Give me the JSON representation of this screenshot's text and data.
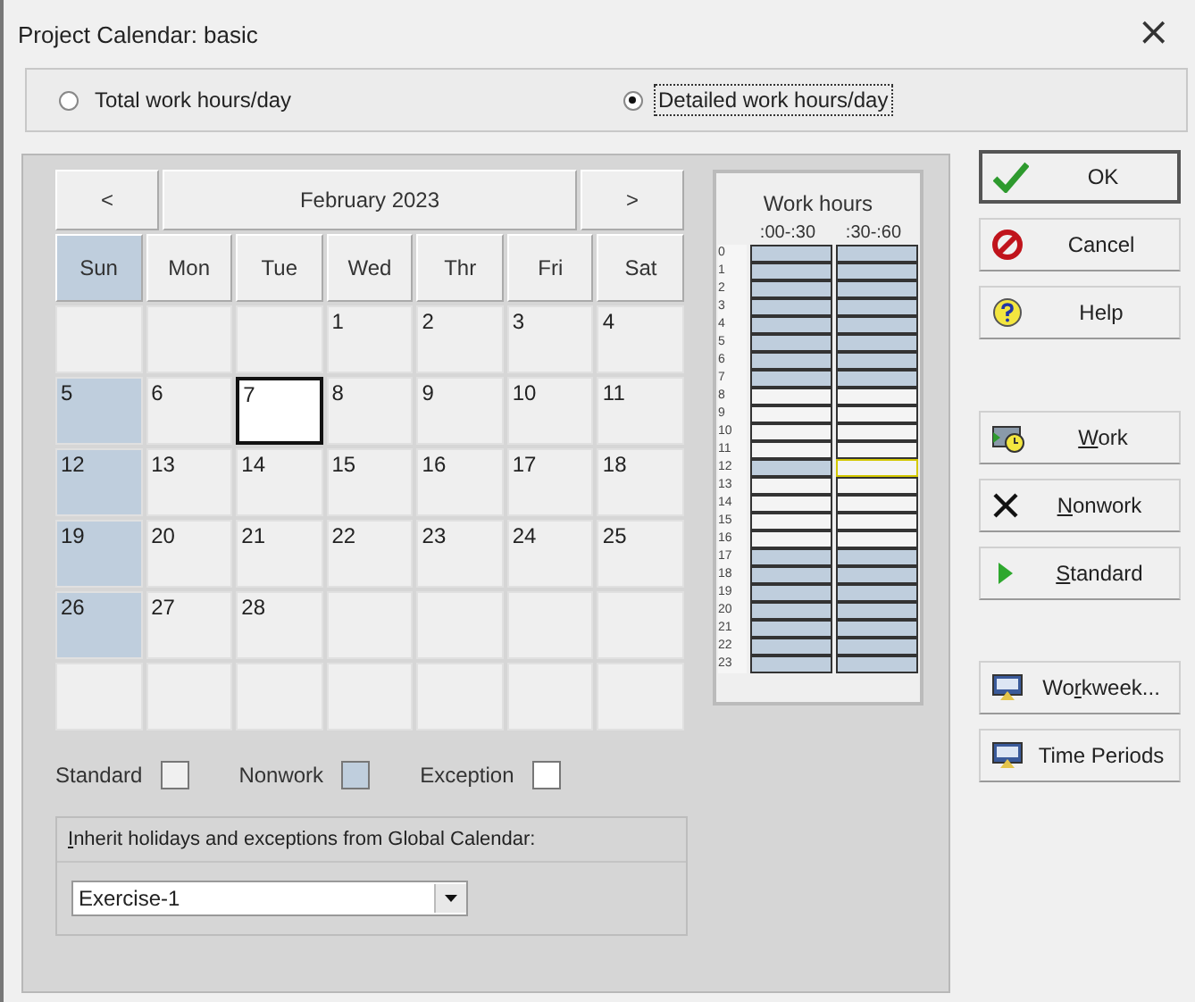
{
  "window": {
    "title": "Project Calendar: basic",
    "close": "×"
  },
  "mode_options": [
    {
      "label": "Total work hours/day",
      "selected": false
    },
    {
      "label": "Detailed work hours/day",
      "selected": true
    }
  ],
  "calendar": {
    "prev": "<",
    "month": "February 2023",
    "next": ">",
    "weekdays": [
      {
        "label": "Sun",
        "nonwork": true
      },
      {
        "label": "Mon",
        "nonwork": false
      },
      {
        "label": "Tue",
        "nonwork": false
      },
      {
        "label": "Wed",
        "nonwork": false
      },
      {
        "label": "Thr",
        "nonwork": false
      },
      {
        "label": "Fri",
        "nonwork": false
      },
      {
        "label": "Sat",
        "nonwork": false
      }
    ],
    "weeks": [
      [
        {
          "nonwork": false,
          "selected": false
        },
        {
          "nonwork": false,
          "selected": false
        },
        {
          "nonwork": false,
          "selected": false
        },
        {
          "day": "1",
          "nonwork": false,
          "selected": false
        },
        {
          "day": "2",
          "nonwork": false,
          "selected": false
        },
        {
          "day": "3",
          "nonwork": false,
          "selected": false
        },
        {
          "day": "4",
          "nonwork": false,
          "selected": false
        }
      ],
      [
        {
          "day": "5",
          "nonwork": true,
          "selected": false
        },
        {
          "day": "6",
          "nonwork": false,
          "selected": false
        },
        {
          "day": "7",
          "nonwork": false,
          "selected": true
        },
        {
          "day": "8",
          "nonwork": false,
          "selected": false
        },
        {
          "day": "9",
          "nonwork": false,
          "selected": false
        },
        {
          "day": "10",
          "nonwork": false,
          "selected": false
        },
        {
          "day": "11",
          "nonwork": false,
          "selected": false
        }
      ],
      [
        {
          "day": "12",
          "nonwork": true,
          "selected": false
        },
        {
          "day": "13",
          "nonwork": false,
          "selected": false
        },
        {
          "day": "14",
          "nonwork": false,
          "selected": false
        },
        {
          "day": "15",
          "nonwork": false,
          "selected": false
        },
        {
          "day": "16",
          "nonwork": false,
          "selected": false
        },
        {
          "day": "17",
          "nonwork": false,
          "selected": false
        },
        {
          "day": "18",
          "nonwork": false,
          "selected": false
        }
      ],
      [
        {
          "day": "19",
          "nonwork": true,
          "selected": false
        },
        {
          "day": "20",
          "nonwork": false,
          "selected": false
        },
        {
          "day": "21",
          "nonwork": false,
          "selected": false
        },
        {
          "day": "22",
          "nonwork": false,
          "selected": false
        },
        {
          "day": "23",
          "nonwork": false,
          "selected": false
        },
        {
          "day": "24",
          "nonwork": false,
          "selected": false
        },
        {
          "day": "25",
          "nonwork": false,
          "selected": false
        }
      ],
      [
        {
          "day": "26",
          "nonwork": true,
          "selected": false
        },
        {
          "day": "27",
          "nonwork": false,
          "selected": false
        },
        {
          "day": "28",
          "nonwork": false,
          "selected": false
        },
        {
          "nonwork": false,
          "selected": false
        },
        {
          "nonwork": false,
          "selected": false
        },
        {
          "nonwork": false,
          "selected": false
        },
        {
          "nonwork": false,
          "selected": false
        }
      ],
      [
        {
          "nonwork": false,
          "selected": false
        },
        {
          "nonwork": false,
          "selected": false
        },
        {
          "nonwork": false,
          "selected": false
        },
        {
          "nonwork": false,
          "selected": false
        },
        {
          "nonwork": false,
          "selected": false
        },
        {
          "nonwork": false,
          "selected": false
        },
        {
          "nonwork": false,
          "selected": false
        }
      ]
    ]
  },
  "work_hours": {
    "title": "Work hours",
    "columns": [
      ":00-:30",
      ":30-:60"
    ],
    "hours": [
      {
        "label": "0",
        "slots": [
          {
            "nonwork": true,
            "selected": false
          },
          {
            "nonwork": true,
            "selected": false
          }
        ]
      },
      {
        "label": "1",
        "slots": [
          {
            "nonwork": true,
            "selected": false
          },
          {
            "nonwork": true,
            "selected": false
          }
        ]
      },
      {
        "label": "2",
        "slots": [
          {
            "nonwork": true,
            "selected": false
          },
          {
            "nonwork": true,
            "selected": false
          }
        ]
      },
      {
        "label": "3",
        "slots": [
          {
            "nonwork": true,
            "selected": false
          },
          {
            "nonwork": true,
            "selected": false
          }
        ]
      },
      {
        "label": "4",
        "slots": [
          {
            "nonwork": true,
            "selected": false
          },
          {
            "nonwork": true,
            "selected": false
          }
        ]
      },
      {
        "label": "5",
        "slots": [
          {
            "nonwork": true,
            "selected": false
          },
          {
            "nonwork": true,
            "selected": false
          }
        ]
      },
      {
        "label": "6",
        "slots": [
          {
            "nonwork": true,
            "selected": false
          },
          {
            "nonwork": true,
            "selected": false
          }
        ]
      },
      {
        "label": "7",
        "slots": [
          {
            "nonwork": true,
            "selected": false
          },
          {
            "nonwork": true,
            "selected": false
          }
        ]
      },
      {
        "label": "8",
        "slots": [
          {
            "nonwork": false,
            "selected": false
          },
          {
            "nonwork": false,
            "selected": false
          }
        ]
      },
      {
        "label": "9",
        "slots": [
          {
            "nonwork": false,
            "selected": false
          },
          {
            "nonwork": false,
            "selected": false
          }
        ]
      },
      {
        "label": "10",
        "slots": [
          {
            "nonwork": false,
            "selected": false
          },
          {
            "nonwork": false,
            "selected": false
          }
        ]
      },
      {
        "label": "11",
        "slots": [
          {
            "nonwork": false,
            "selected": false
          },
          {
            "nonwork": false,
            "selected": false
          }
        ]
      },
      {
        "label": "12",
        "slots": [
          {
            "nonwork": true,
            "selected": false
          },
          {
            "nonwork": false,
            "selected": true
          }
        ]
      },
      {
        "label": "13",
        "slots": [
          {
            "nonwork": false,
            "selected": false
          },
          {
            "nonwork": false,
            "selected": false
          }
        ]
      },
      {
        "label": "14",
        "slots": [
          {
            "nonwork": false,
            "selected": false
          },
          {
            "nonwork": false,
            "selected": false
          }
        ]
      },
      {
        "label": "15",
        "slots": [
          {
            "nonwork": false,
            "selected": false
          },
          {
            "nonwork": false,
            "selected": false
          }
        ]
      },
      {
        "label": "16",
        "slots": [
          {
            "nonwork": false,
            "selected": false
          },
          {
            "nonwork": false,
            "selected": false
          }
        ]
      },
      {
        "label": "17",
        "slots": [
          {
            "nonwork": true,
            "selected": false
          },
          {
            "nonwork": true,
            "selected": false
          }
        ]
      },
      {
        "label": "18",
        "slots": [
          {
            "nonwork": true,
            "selected": false
          },
          {
            "nonwork": true,
            "selected": false
          }
        ]
      },
      {
        "label": "19",
        "slots": [
          {
            "nonwork": true,
            "selected": false
          },
          {
            "nonwork": true,
            "selected": false
          }
        ]
      },
      {
        "label": "20",
        "slots": [
          {
            "nonwork": true,
            "selected": false
          },
          {
            "nonwork": true,
            "selected": false
          }
        ]
      },
      {
        "label": "21",
        "slots": [
          {
            "nonwork": true,
            "selected": false
          },
          {
            "nonwork": true,
            "selected": false
          }
        ]
      },
      {
        "label": "22",
        "slots": [
          {
            "nonwork": true,
            "selected": false
          },
          {
            "nonwork": true,
            "selected": false
          }
        ]
      },
      {
        "label": "23",
        "slots": [
          {
            "nonwork": true,
            "selected": false
          },
          {
            "nonwork": true,
            "selected": false
          }
        ]
      }
    ]
  },
  "legend": [
    {
      "label": "Standard",
      "kind": "standard"
    },
    {
      "label": "Nonwork",
      "kind": "nonwork"
    },
    {
      "label": "Exception",
      "kind": "exception"
    }
  ],
  "global_calendar": {
    "label": [
      {
        "text": "I",
        "underlined": true
      },
      {
        "text": "nherit holidays and exceptions from Global Calendar:",
        "underlined": false
      }
    ],
    "value": "Exercise-1"
  },
  "button_groups": [
    [
      {
        "label": [
          {
            "text": "OK",
            "underlined": false
          }
        ],
        "kind": "ok",
        "default": true
      },
      {
        "label": [
          {
            "text": "Cancel",
            "underlined": false
          }
        ],
        "kind": "cancel",
        "default": false
      },
      {
        "label": [
          {
            "text": "Help",
            "underlined": false
          }
        ],
        "kind": "help",
        "default": false
      }
    ],
    [
      {
        "label": [
          {
            "text": "W",
            "underlined": true
          },
          {
            "text": "ork",
            "underlined": false
          }
        ],
        "kind": "work",
        "default": false
      },
      {
        "label": [
          {
            "text": "N",
            "underlined": true
          },
          {
            "text": "onwork",
            "underlined": false
          }
        ],
        "kind": "nonwork",
        "default": false
      },
      {
        "label": [
          {
            "text": "S",
            "underlined": true
          },
          {
            "text": "tandard",
            "underlined": false
          }
        ],
        "kind": "standard",
        "default": false
      }
    ],
    [
      {
        "label": [
          {
            "text": "Wo",
            "underlined": false
          },
          {
            "text": "r",
            "underlined": true
          },
          {
            "text": "kweek...",
            "underlined": false
          }
        ],
        "kind": "screen",
        "default": false
      },
      {
        "label": [
          {
            "text": "Time Periods",
            "underlined": false
          }
        ],
        "kind": "screen",
        "default": false
      }
    ]
  ]
}
